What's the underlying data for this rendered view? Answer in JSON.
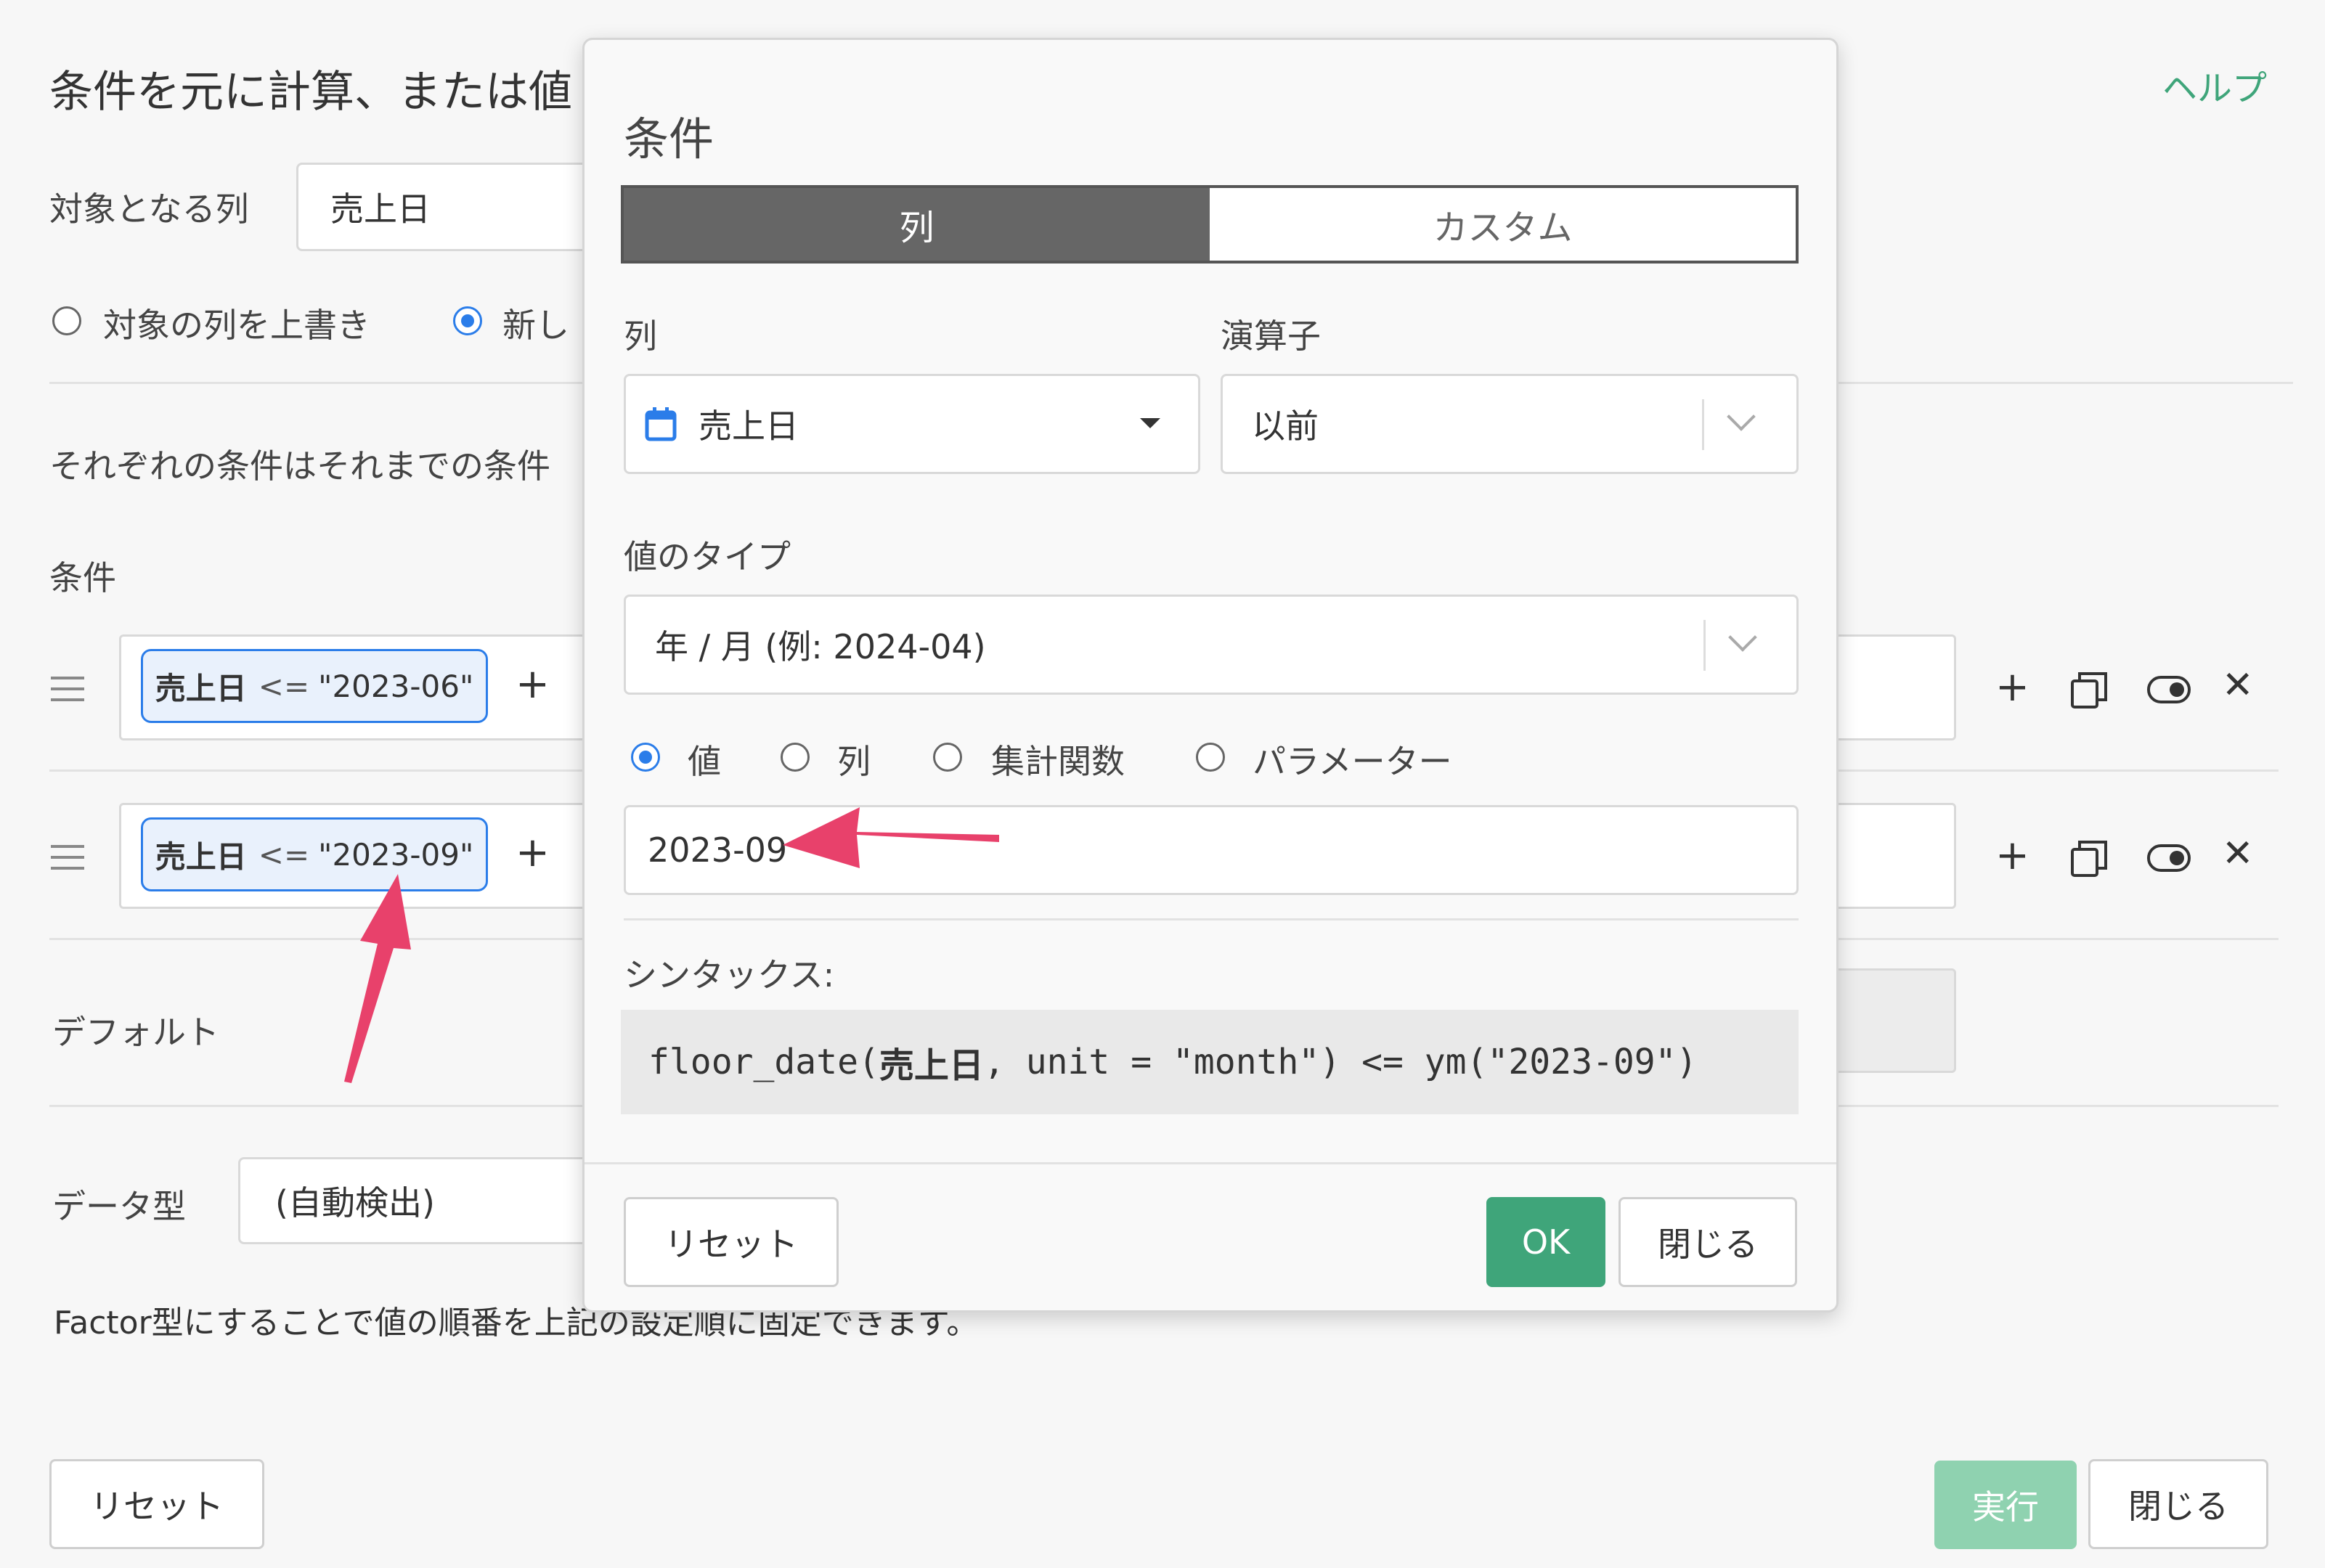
{
  "background": {
    "title": "条件を元に計算、または値",
    "help": "ヘルプ",
    "target_column_label": "対象となる列",
    "target_column_value": "売上日",
    "radio_overwrite": "対象の列を上書き",
    "radio_new": "新し",
    "description": "それぞれの条件はそれまでの条件",
    "conditions_label": "条件",
    "conditions": [
      {
        "column": "売上日",
        "op": "<=",
        "value": "\"2023-06\""
      },
      {
        "column": "売上日",
        "op": "<=",
        "value": "\"2023-09\""
      }
    ],
    "plus": "+",
    "default_label": "デフォルト",
    "data_type_label": "データ型",
    "data_type_value": "(自動検出)",
    "factor_note": "Factor型にすることで値の順番を上記の設定順に固定できます。",
    "reset": "リセット",
    "run": "実行",
    "close": "閉じる"
  },
  "dialog": {
    "title": "条件",
    "tabs": {
      "column": "列",
      "custom": "カスタム"
    },
    "column_label": "列",
    "column_value": "売上日",
    "operator_label": "演算子",
    "operator_value": "以前",
    "value_type_label": "値のタイプ",
    "value_type_value": "年 / 月 (例: 2024-04)",
    "value_modes": [
      "値",
      "列",
      "集計関数",
      "パラメーター"
    ],
    "value_input": "2023-09",
    "syntax_label": "シンタックス:",
    "syntax_pre": "floor_date(",
    "syntax_bold": "売上日",
    "syntax_post": ", unit = \"month\") <= ym(\"2023-09\")",
    "reset": "リセット",
    "ok": "OK",
    "close": "閉じる"
  },
  "colors": {
    "accent": "#2b7de9",
    "green": "#3fa57a",
    "annotation_arrow": "#e8416b"
  }
}
